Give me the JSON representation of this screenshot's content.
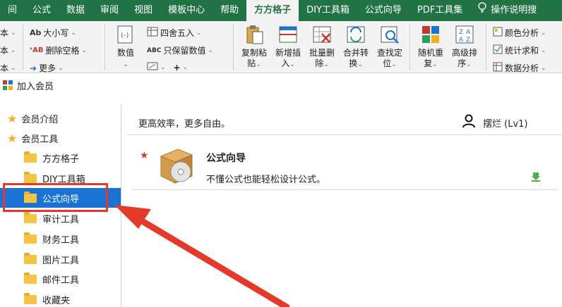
{
  "ribbon_tabs": [
    "间",
    "公式",
    "数据",
    "审阅",
    "视图",
    "模板中心",
    "帮助",
    "方方格子",
    "DIY工具箱",
    "公式向导",
    "PDF工具集",
    "操作说明搜"
  ],
  "ribbon": {
    "left_cut": [
      "本",
      "本",
      "本"
    ],
    "case_label": "大小写",
    "case_icon": "Ab",
    "delspace_label": "删除空格",
    "delspace_icon": "ˣAB",
    "more_label": "更多",
    "numeric_label": "数值",
    "round_label": "四舍五入",
    "keepnum_label": "只保留数值",
    "keepnum_icon": "ABC",
    "plus_label": "+",
    "copy_paste": "复制粘贴",
    "add_insert": "新增插入",
    "batch_delete": "批量删除",
    "merge_convert": "合并转换",
    "find_locate": "查找定位",
    "random_repeat": "随机重复",
    "advanced_sort": "高级排序",
    "color_analysis": "颜色分析",
    "stats_sum": "统计求和",
    "data_analysis": "数据分析"
  },
  "window": {
    "title": "加入会员"
  },
  "tree": {
    "items": [
      {
        "label": "会员介绍",
        "icon": "star-icon"
      },
      {
        "label": "会员工具",
        "icon": "star-icon"
      },
      {
        "label": "方方格子",
        "icon": "folder-icon"
      },
      {
        "label": "DIY工具箱",
        "icon": "folder-icon"
      },
      {
        "label": "公式向导",
        "icon": "folder-icon",
        "selected": true
      },
      {
        "label": "审计工具",
        "icon": "folder-icon"
      },
      {
        "label": "财务工具",
        "icon": "folder-icon"
      },
      {
        "label": "图片工具",
        "icon": "folder-icon"
      },
      {
        "label": "邮件工具",
        "icon": "folder-icon"
      },
      {
        "label": "收藏夹",
        "icon": "folder-icon"
      }
    ]
  },
  "panel": {
    "slogan": "更高效率，更多自由。",
    "user": "摆烂 (Lv1)",
    "product": {
      "name": "公式向导",
      "desc": "不懂公式也能轻松设计公式。"
    }
  },
  "colors": {
    "ribbon_green": "#217346",
    "select_blue": "#1a73d4",
    "highlight_red": "#e53a2a"
  }
}
